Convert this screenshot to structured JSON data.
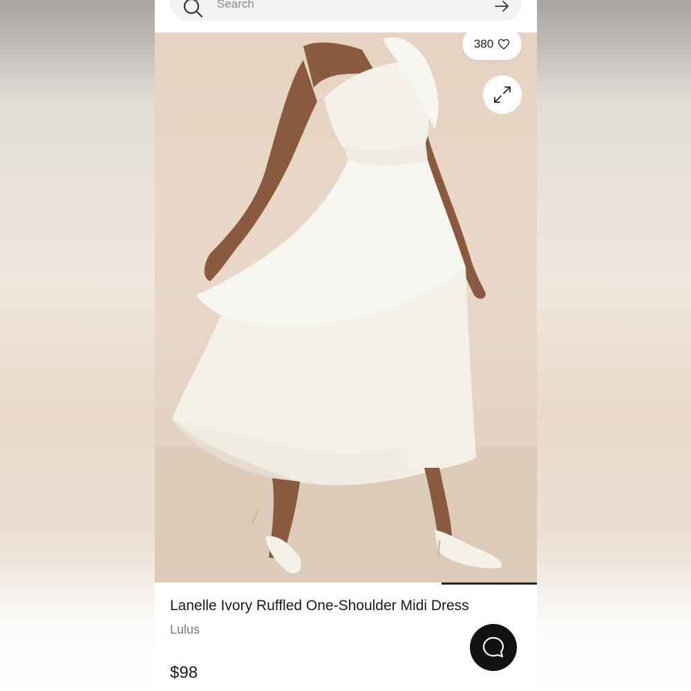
{
  "search": {
    "placeholder": "Search"
  },
  "gallery": {
    "like_count": "380",
    "progress_fraction": 0.25
  },
  "product": {
    "title": "Lanelle Ivory Ruffled One-Shoulder Midi Dress",
    "brand": "Lulus",
    "price": "$98"
  },
  "icons": {
    "search": "search-icon",
    "arrow": "arrow-right-icon",
    "heart": "heart-icon",
    "expand": "expand-icon",
    "chat": "chat-icon"
  },
  "colors": {
    "accent": "#111111",
    "background": "#ffffff"
  }
}
